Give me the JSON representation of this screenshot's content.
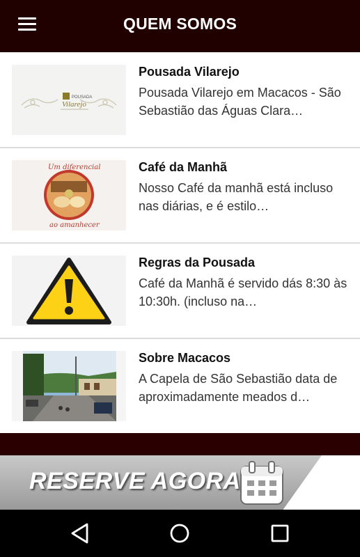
{
  "appbar": {
    "title": "QUEM SOMOS",
    "menu_icon": "menu-icon"
  },
  "items": [
    {
      "title": "Pousada Vilarejo",
      "description": "Pousada Vilarejo em Macacos - São Sebastião das Águas Clara…",
      "thumb": "pousada-logo",
      "logo_small": "POUSADA",
      "logo_large": "Vilarejo"
    },
    {
      "title": "Café da Manhã",
      "description": "Nosso Café da manhã está incluso nas diárias, e é estilo…",
      "thumb": "breakfast-photo",
      "caption_top": "Um diferencial",
      "caption_bottom": "ao amanhecer"
    },
    {
      "title": "Regras da Pousada",
      "description": "Café da Manhã é servido dás 8:30 às 10:30h. (incluso na…",
      "thumb": "warning-icon"
    },
    {
      "title": "Sobre Macacos",
      "description": "A Capela de São Sebastião data de aproximadamente meados d…",
      "thumb": "street-photo"
    }
  ],
  "banner": {
    "text": "RESERVE AGORA!",
    "icon": "calendar-icon"
  },
  "navbar": {
    "back_icon": "back-icon",
    "home_icon": "home-icon",
    "recents_icon": "recents-icon"
  },
  "colors": {
    "appbar": "#210000",
    "band": "#2b0000",
    "warning": "#fcd116"
  }
}
